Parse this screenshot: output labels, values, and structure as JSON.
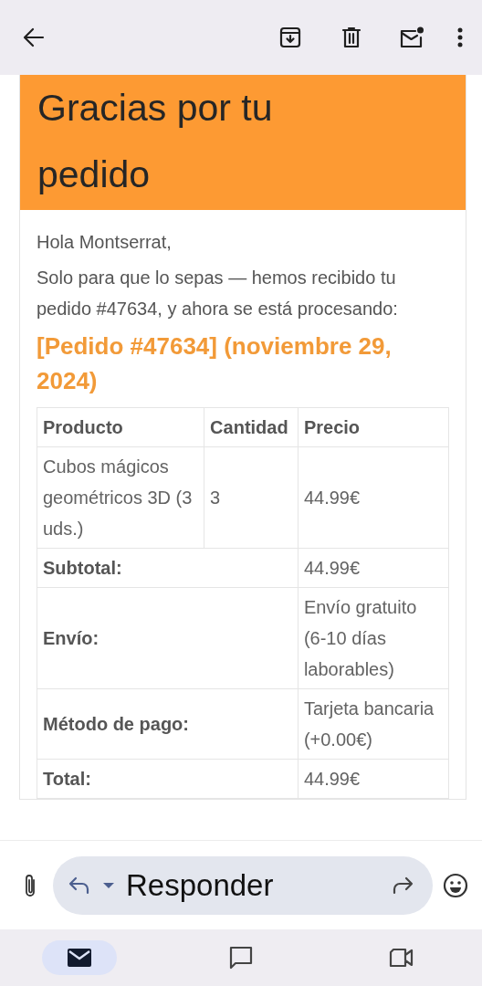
{
  "email": {
    "title": "Gracias por tu pedido",
    "greeting": "Hola Montserrat,",
    "intro": "Solo para que lo sepas — hemos recibido tu pedido #47634, y ahora se está procesando:",
    "order_heading": "[Pedido #47634] (noviembre 29, 2024)",
    "table": {
      "columns": [
        "Producto",
        "Cantidad",
        "Precio"
      ],
      "rows": [
        {
          "cells": [
            "Cubos mágicos geométricos 3D (3 uds.)",
            "3",
            "44.99€"
          ]
        }
      ],
      "totals": [
        {
          "label": "Subtotal:",
          "value": "44.99€"
        },
        {
          "label": "Envío:",
          "value": "Envío gratuito (6-10 días laborables)"
        },
        {
          "label": "Método de pago:",
          "value": "Tarjeta bancaria (+0.00€)"
        },
        {
          "label": "Total:",
          "value": "44.99€"
        }
      ]
    }
  },
  "reply_bar": {
    "label": "Responder"
  },
  "nav": [
    {
      "kind": "mail",
      "selected": true
    },
    {
      "kind": "chat",
      "selected": false
    },
    {
      "kind": "video",
      "selected": false
    }
  ]
}
